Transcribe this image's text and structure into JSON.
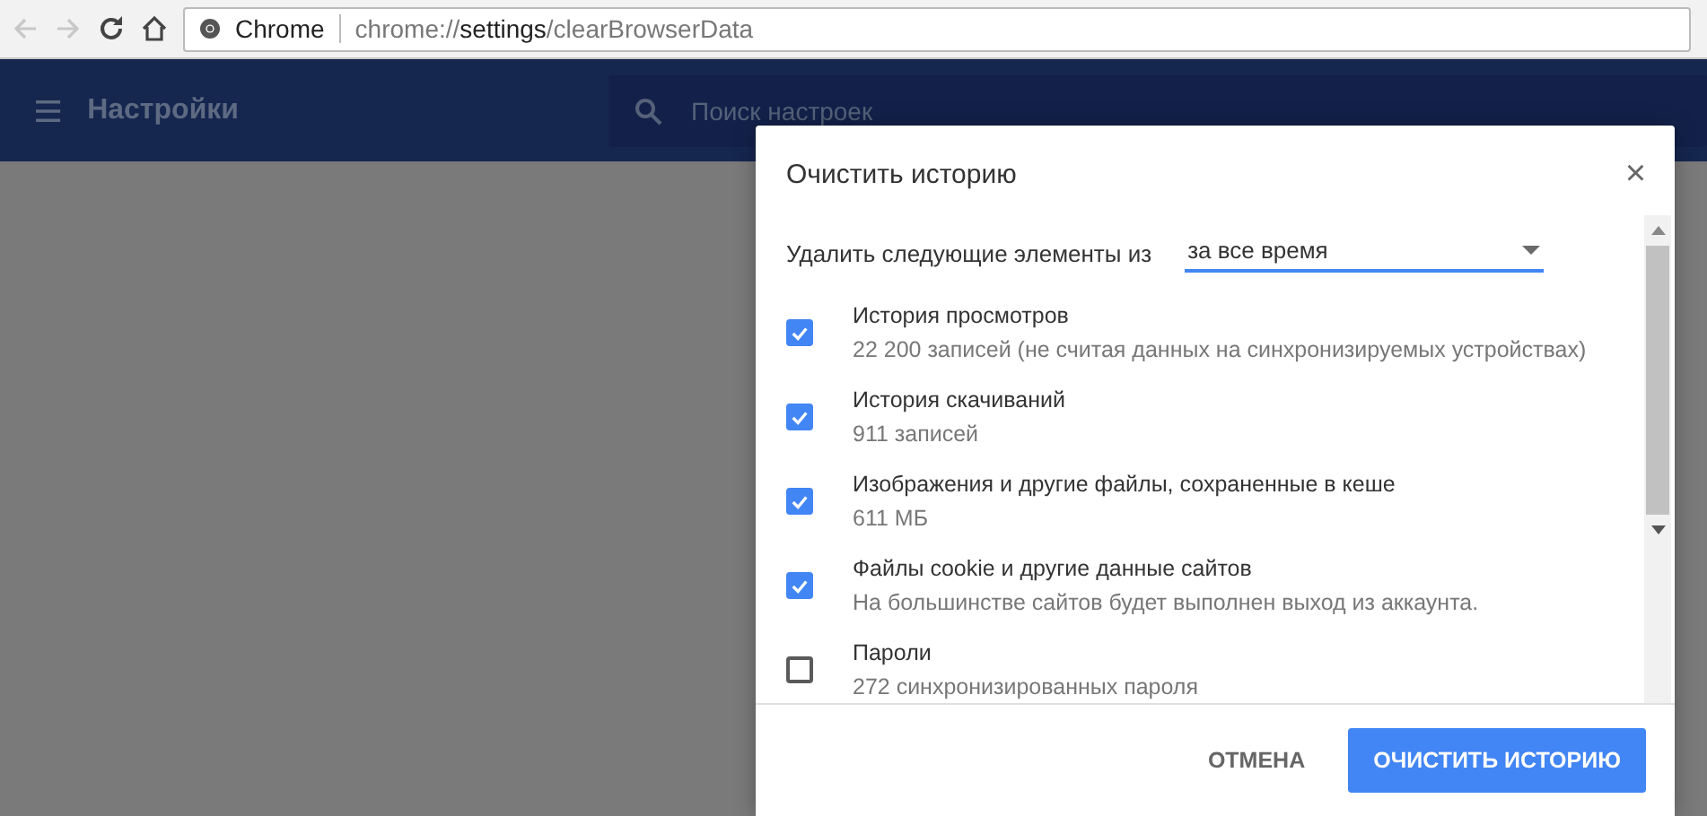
{
  "toolbar": {
    "site_label": "Chrome",
    "url_host": "chrome://",
    "url_path": "settings",
    "url_rest": "/clearBrowserData"
  },
  "header": {
    "title": "Настройки",
    "search": {
      "placeholder": "Поиск настроек"
    }
  },
  "dialog": {
    "title": "Очистить историю",
    "close": "×",
    "range_label": "Удалить следующие элементы из",
    "range_value": "за все время",
    "items": [
      {
        "title": "История просмотров",
        "detail": "22 200 записей (не считая данных на синхронизируемых устройствах)",
        "checked": true
      },
      {
        "title": "История скачиваний",
        "detail": "911 записей",
        "checked": true
      },
      {
        "title": "Изображения и другие файлы, сохраненные в кеше",
        "detail": "611 МБ",
        "checked": true
      },
      {
        "title": "Файлы cookie и другие данные сайтов",
        "detail": "На большинстве сайтов будет выполнен выход из аккаунта.",
        "checked": true
      },
      {
        "title": "Пароли",
        "detail": "272 синхронизированных пароля",
        "checked": false
      }
    ],
    "buttons": {
      "cancel": "ОТМЕНА",
      "confirm": "ОЧИСТИТЬ ИСТОРИЮ"
    }
  }
}
